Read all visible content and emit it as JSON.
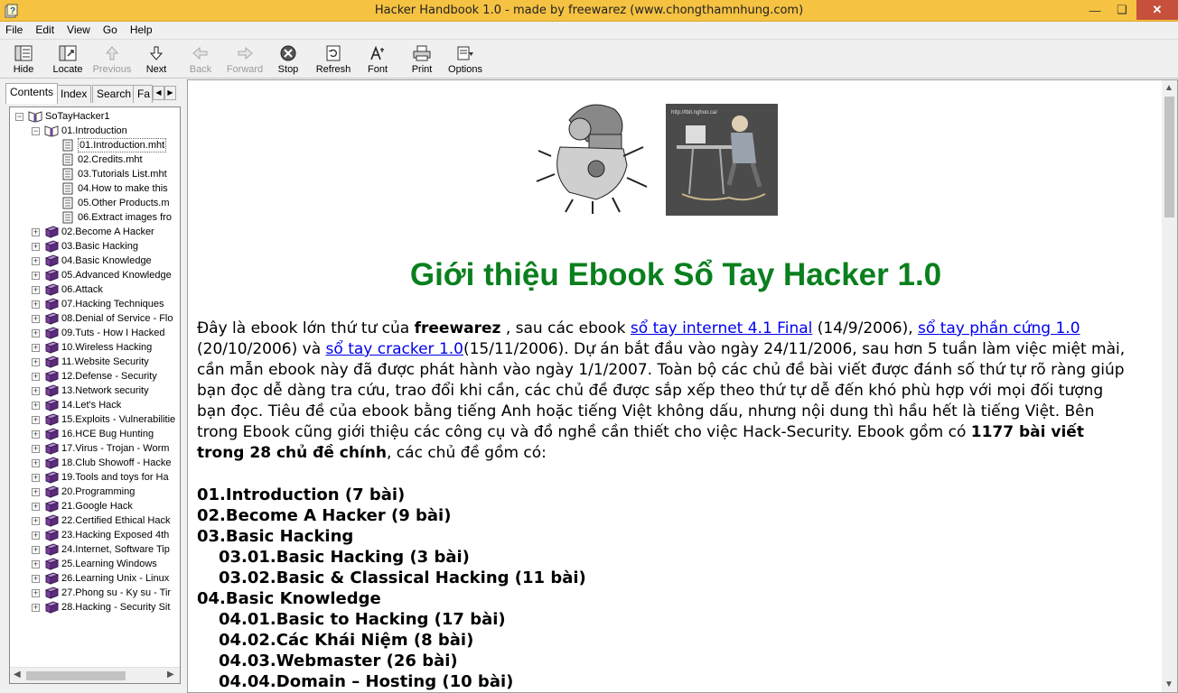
{
  "window": {
    "title": "Hacker Handbook 1.0 - made by freewarez (www.chongthamnhung.com)",
    "min_glyph": "—",
    "max_glyph": "❏",
    "close_glyph": "✕"
  },
  "menu": [
    "File",
    "Edit",
    "View",
    "Go",
    "Help"
  ],
  "toolbar": [
    {
      "label": "Hide",
      "icon": "hide-icon",
      "enabled": true
    },
    {
      "label": "Locate",
      "icon": "locate-icon",
      "enabled": true
    },
    {
      "label": "Previous",
      "icon": "previous-icon",
      "enabled": false
    },
    {
      "label": "Next",
      "icon": "next-icon",
      "enabled": true
    },
    {
      "label": "Back",
      "icon": "back-icon",
      "enabled": false
    },
    {
      "label": "Forward",
      "icon": "forward-icon",
      "enabled": false
    },
    {
      "label": "Stop",
      "icon": "stop-icon",
      "enabled": true
    },
    {
      "label": "Refresh",
      "icon": "refresh-icon",
      "enabled": true
    },
    {
      "label": "Font",
      "icon": "font-icon",
      "enabled": true
    },
    {
      "label": "Print",
      "icon": "print-icon",
      "enabled": true
    },
    {
      "label": "Options",
      "icon": "options-icon",
      "enabled": true
    }
  ],
  "tabs": [
    "Contents",
    "Index",
    "Search",
    "Fa"
  ],
  "tree": {
    "root": "SoTayHacker1",
    "open_folder": "01.Introduction",
    "pages": [
      "01.Introduction.mht",
      "02.Credits.mht",
      "03.Tutorials List.mht",
      "04.How to make this",
      "05.Other Products.m",
      "06.Extract images fro"
    ],
    "folders": [
      "02.Become A Hacker",
      "03.Basic Hacking",
      "04.Basic Knowledge",
      "05.Advanced Knowledge",
      "06.Attack",
      "07.Hacking Techniques",
      "08.Denial of Service - Flo",
      "09.Tuts - How I Hacked",
      "10.Wireless Hacking",
      "11.Website Security",
      "12.Defense - Security",
      "13.Network security",
      "14.Let's Hack",
      "15.Exploits - Vulnerabilitie",
      "16.HCE Bug Hunting",
      "17.Virus - Trojan - Worm",
      "18.Club Showoff - Hacke",
      "19.Tools and toys for Ha",
      "20.Programming",
      "21.Google Hack",
      "22.Certified Ethical Hack",
      "23.Hacking Exposed 4th",
      "24.Internet, Software Tip",
      "25.Learning Windows",
      "26.Learning Unix - Linux",
      "27.Phong su - Ky su - Tir",
      "28.Hacking - Security Sit"
    ]
  },
  "photo_caption": "http://tbit.nghoo.ca/",
  "article": {
    "heading": "Giới thiệu Ebook Sổ Tay Hacker 1.0",
    "p_start": "Đây là ebook lớn thứ tư của ",
    "brand": "freewarez",
    "p_after_brand": " , sau các ebook ",
    "link1": "sổ tay internet 4.1 Final",
    "p_after_link1": " (14/9/2006), ",
    "link2": "sổ tay phần cứng 1.0",
    "p_after_link2": " (20/10/2006) và ",
    "link3": "sổ tay cracker 1.0",
    "p_body": "(15/11/2006). Dự án bắt đầu vào ngày 24/11/2006, sau hơn 5 tuần làm việc miệt mài, cần mẫn ebook này đã được phát hành vào ngày 1/1/2007. Toàn bộ các chủ đề bài viết được đánh số thứ tự rõ ràng giúp bạn đọc dễ dàng tra cứu, trao đổi khi cần, các chủ đề được sắp xếp theo thứ tự dễ đến khó phù hợp với mọi đối tượng bạn đọc. Tiêu đề của ebook bằng tiếng Anh hoặc tiếng Việt không dấu, nhưng nội dung thì hầu hết là tiếng Việt. Bên trong Ebook cũng giới thiệu các công cụ và đồ nghề cần thiết cho việc Hack-Security.  Ebook gồm có ",
    "p_bold_count": "1177 bài viết trong 28 chủ đề chính",
    "p_end": ", các chủ đề gồm có:",
    "toc": [
      {
        "text": "01.Introduction (7 bài)",
        "sub": false
      },
      {
        "text": "02.Become A Hacker (9 bài)",
        "sub": false
      },
      {
        "text": "03.Basic Hacking",
        "sub": false
      },
      {
        "text": "03.01.Basic Hacking (3 bài)",
        "sub": true
      },
      {
        "text": "03.02.Basic & Classical Hacking (11 bài)",
        "sub": true
      },
      {
        "text": "04.Basic Knowledge",
        "sub": false
      },
      {
        "text": "04.01.Basic to Hacking (17 bài)",
        "sub": true
      },
      {
        "text": "04.02.Các Khái Niệm  (8 bài)",
        "sub": true
      },
      {
        "text": "04.03.Webmaster  (26 bài)",
        "sub": true
      },
      {
        "text": "04.04.Domain – Hosting (10 bài)",
        "sub": true
      }
    ]
  },
  "colors": {
    "titlebar": "#f5c242",
    "heading_green": "#0a7f1e",
    "link_blue": "#0000ee",
    "book_purple": "#7a3f9e"
  }
}
